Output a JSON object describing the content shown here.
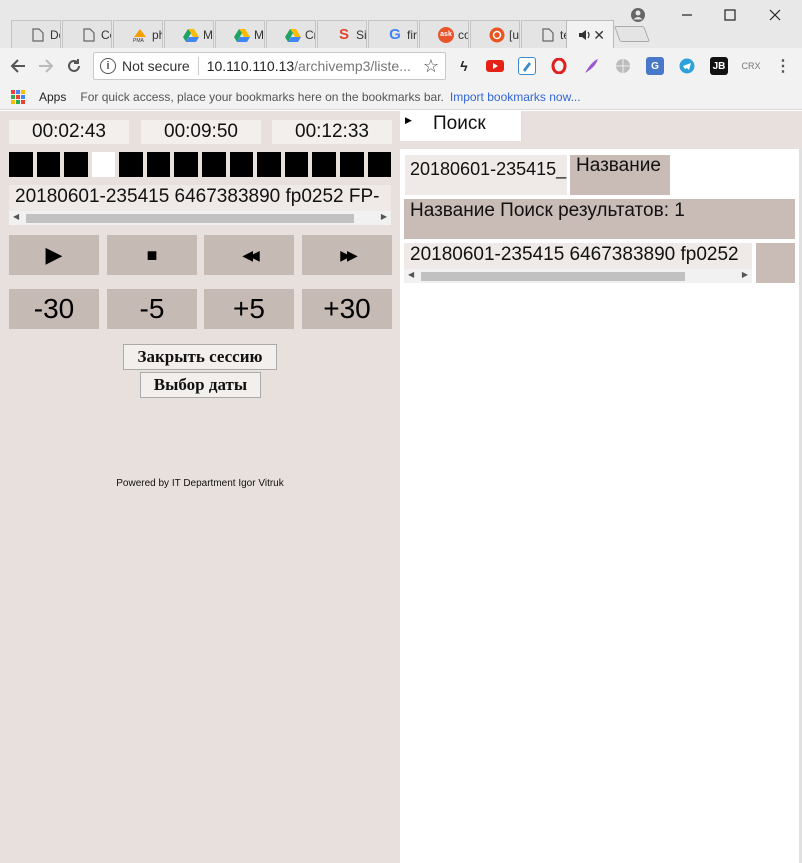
{
  "browser": {
    "tabs": [
      {
        "label": "Dc",
        "icon": "document-icon"
      },
      {
        "label": "Ce",
        "icon": "document-icon"
      },
      {
        "label": "ph",
        "icon": "pma-icon"
      },
      {
        "label": "M",
        "icon": "drive-icon"
      },
      {
        "label": "M",
        "icon": "drive-icon"
      },
      {
        "label": "Ск",
        "icon": "drive-icon"
      },
      {
        "label": "Sin",
        "icon": "s-logo-icon"
      },
      {
        "label": "fir",
        "icon": "google-icon"
      },
      {
        "label": "co",
        "icon": "ask-icon"
      },
      {
        "label": "[u",
        "icon": "ubuntu-icon"
      },
      {
        "label": "te",
        "icon": "document-icon"
      },
      {
        "label": "",
        "icon": "speaker-icon",
        "active": true
      }
    ],
    "address": {
      "security": "Not secure",
      "host": "10.110.110.13",
      "path": "/archivemp3/liste..."
    },
    "bookmarks": {
      "apps_label": "Apps",
      "hint": "For quick access, place your bookmarks here on the bookmarks bar.",
      "import_link": "Import bookmarks now..."
    },
    "extensions": [
      "bolt-icon",
      "youtube-icon",
      "pen-icon",
      "opera-icon",
      "feather-icon",
      "globe-icon",
      "translate-icon",
      "telegram-icon",
      "jb-icon",
      "crx-icon"
    ],
    "extension_labels": {
      "jb": "JB",
      "crx": "CRX"
    }
  },
  "player": {
    "time_elapsed": "00:02:43",
    "time_remaining": "00:09:50",
    "time_total": "00:12:33",
    "level_segments_total": 14,
    "level_segment_lit": 4,
    "current_track": "20180601-235415 6467383890 fp0252 FP-",
    "controls": {
      "play": "▶",
      "stop": "■",
      "rewind": "◀◀",
      "forward": "▶▶"
    },
    "skip": {
      "back30": "-30",
      "back5": "-5",
      "fwd5": "+5",
      "fwd30": "+30"
    },
    "close_session": "Закрыть сессию",
    "select_date": "Выбор даты",
    "powered_by": "Powered by IT Department Igor Vitruk"
  },
  "search": {
    "tab_label": "Поиск",
    "query": "20180601-235415_",
    "sort_label": "Название",
    "results_header": "Название Поиск результатов: 1",
    "result_item": "20180601-235415 6467383890 fp0252"
  }
}
